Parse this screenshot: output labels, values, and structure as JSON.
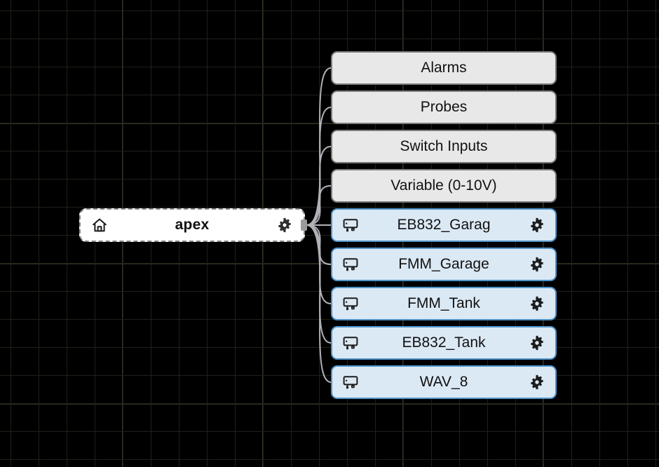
{
  "canvas": {
    "background_color": "#000000",
    "grid_color": "#1e2118",
    "grid_major_color": "#2e3325",
    "edge_color": "#b1b1b7"
  },
  "root_node": {
    "id": "apex",
    "title": "apex",
    "home_icon": "home-icon",
    "settings_icon": "gear-icon",
    "selected": true,
    "fill_color": "#ffffff",
    "border_color": "#8a8a8a"
  },
  "child_nodes": [
    {
      "label": "Alarms",
      "kind": "plain",
      "has_device_icon": false,
      "has_gear_icon": false,
      "fill_color": "#e8e8e8",
      "border_color": "#7b7b7b"
    },
    {
      "label": "Probes",
      "kind": "plain",
      "has_device_icon": false,
      "has_gear_icon": false,
      "fill_color": "#e8e8e8",
      "border_color": "#7b7b7b"
    },
    {
      "label": "Switch Inputs",
      "kind": "plain",
      "has_device_icon": false,
      "has_gear_icon": false,
      "fill_color": "#e8e8e8",
      "border_color": "#7b7b7b"
    },
    {
      "label": "Variable (0-10V)",
      "kind": "plain",
      "has_device_icon": false,
      "has_gear_icon": false,
      "fill_color": "#e8e8e8",
      "border_color": "#7b7b7b"
    },
    {
      "label": "EB832_Garag",
      "kind": "device",
      "has_device_icon": true,
      "has_gear_icon": true,
      "device_icon": "device-display-icon",
      "settings_icon": "gear-icon",
      "fill_color": "#dbe9f5",
      "border_color": "#4f93c8"
    },
    {
      "label": "FMM_Garage",
      "kind": "device",
      "has_device_icon": true,
      "has_gear_icon": true,
      "device_icon": "device-display-icon",
      "settings_icon": "gear-icon",
      "fill_color": "#dbe9f5",
      "border_color": "#4f93c8"
    },
    {
      "label": "FMM_Tank",
      "kind": "device",
      "has_device_icon": true,
      "has_gear_icon": true,
      "device_icon": "device-display-icon",
      "settings_icon": "gear-icon",
      "fill_color": "#dbe9f5",
      "border_color": "#4f93c8"
    },
    {
      "label": "EB832_Tank",
      "kind": "device",
      "has_device_icon": true,
      "has_gear_icon": true,
      "device_icon": "device-display-icon",
      "settings_icon": "gear-icon",
      "fill_color": "#dbe9f5",
      "border_color": "#4f93c8"
    },
    {
      "label": "WAV_8",
      "kind": "device",
      "has_device_icon": true,
      "has_gear_icon": true,
      "device_icon": "device-display-icon",
      "settings_icon": "gear-icon",
      "fill_color": "#dbe9f5",
      "border_color": "#4f93c8"
    }
  ]
}
